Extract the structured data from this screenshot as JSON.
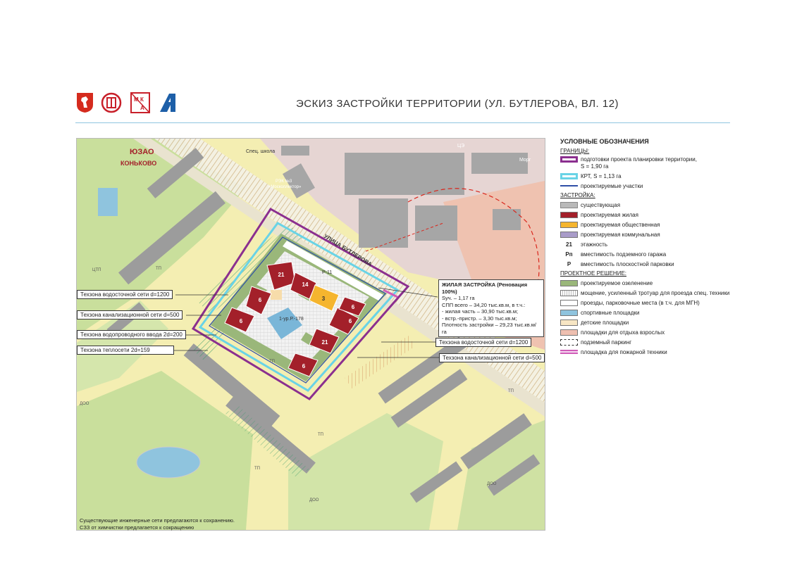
{
  "header": {
    "title": "ЭСКИЗ ЗАСТРОЙКИ ТЕРРИТОРИИ (УЛ. БУТЛЕРОВА, ВЛ. 12)",
    "logo_letters": "МКА"
  },
  "map": {
    "district": "ЮЗАО",
    "subdistrict": "КОНЬКОВО",
    "street": "УЛИЦА БУТЛЕРОВА",
    "plot_label": "1-ур.Р.-178",
    "road_label": "Р-11",
    "school_label": "Спец. школа",
    "rsk_label": "РЭК №3\n«Москоллектор»",
    "center_label": "ЦЭ",
    "morg_label": "Морг",
    "admin_label": "Административное\nздание",
    "misc_labels": [
      "ЦТП",
      "ТП",
      "ТП",
      "ТП",
      "ТП",
      "ДОО",
      "ДОО",
      "ДОО",
      "ТП"
    ],
    "building_floors": [
      "21",
      "14",
      "6",
      "6",
      "6",
      "21",
      "6",
      "6"
    ],
    "public_building_floor": "3"
  },
  "callouts": [
    "Техзона водосточной сети d=1200",
    "Техзона канализационной сети d=500",
    "Техзона водопроводного ввода 2d=200",
    "Техзона теплосети 2d=159",
    "Техзона водосточной сети d=1200",
    "Техзона канализационной сети d=500"
  ],
  "info_box": {
    "title": "ЖИЛАЯ ЗАСТРОЙКА (Реновация 100%)",
    "lines": [
      "Sуч. – 1,17 га",
      "СПП всего – 34,20 тыс.кв.м, в т.ч.:",
      "- жилая часть – 30,90 тыс.кв.м;",
      "- встр.-пристр. – 3,30 тыс.кв.м;",
      "Плотность застройки – 29,23 тыс.кв.м/га"
    ]
  },
  "legend": {
    "title": "УСЛОВНЫЕ ОБОЗНАЧЕНИЯ",
    "sections": [
      {
        "name": "ГРАНИЦЫ:",
        "items": [
          {
            "label": "подготовки проекта планировки территории,\nS = 1,90 га",
            "swatch": "border-purple"
          },
          {
            "label": "КРТ, S = 1,13 га",
            "swatch": "border-cyan"
          },
          {
            "label": "проектируемые участки",
            "swatch": "line-blue"
          }
        ]
      },
      {
        "name": "ЗАСТРОЙКА:",
        "items": [
          {
            "label": "существующая",
            "swatch": "fill-gray"
          },
          {
            "label": "проектируемая жилая",
            "swatch": "fill-red"
          },
          {
            "label": "проектируемая общественная",
            "swatch": "fill-orange"
          },
          {
            "label": "проектируемая коммунальная",
            "swatch": "fill-lilac"
          },
          {
            "label": "этажность",
            "symbol": "21"
          },
          {
            "label": "вместимость подземного гаража",
            "symbol": "Pп"
          },
          {
            "label": "вместимость плоскостной парковки",
            "symbol": "P"
          }
        ]
      },
      {
        "name": "ПРОЕКТНОЕ РЕШЕНИЕ:",
        "items": [
          {
            "label": "проектируемое озеленение",
            "swatch": "fill-green"
          },
          {
            "label": "мощение, усиленный тротуар для проезда спец. техники",
            "swatch": "fill-paving"
          },
          {
            "label": "проезды, парковочные места (в т.ч. для МГН)",
            "swatch": "fill-white"
          },
          {
            "label": "спортивные площадки",
            "swatch": "fill-blue"
          },
          {
            "label": "детские площадки",
            "swatch": "fill-cream"
          },
          {
            "label": "площадки для отдыха взрослых",
            "swatch": "fill-pink"
          },
          {
            "label": "подземный паркинг",
            "swatch": "dashed"
          },
          {
            "label": "площадка для пожарной техники",
            "swatch": "fire"
          }
        ]
      }
    ]
  },
  "notes": [
    "Существующие инженерные сети предлагаются к сохранению.",
    "СЗЗ от химчистки предлагается к сокращению"
  ],
  "colors": {
    "residential": "#a3202a",
    "public": "#f5b52e",
    "existing": "#b9b9b9",
    "greening": "#9ab77a",
    "boundary_purple": "#8b2f8f",
    "boundary_cyan": "#69d3e6",
    "background_yellow": "#f4eeb2",
    "background_green": "#c9df9c"
  }
}
